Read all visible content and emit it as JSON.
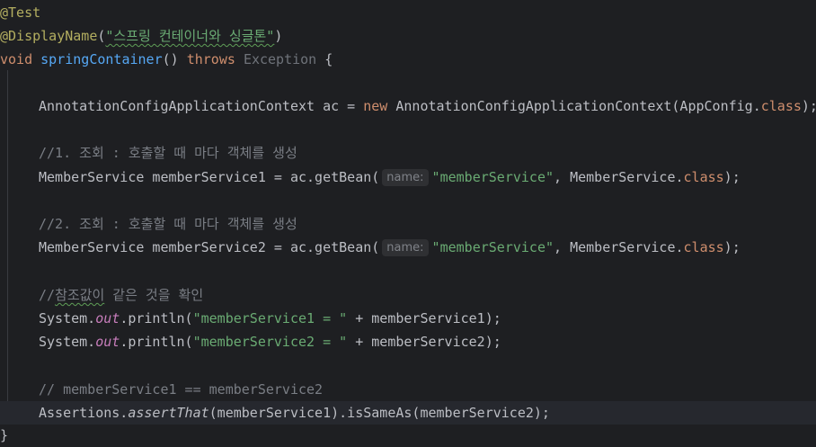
{
  "code": {
    "l1_annotation": "@Test",
    "l2_annotation": "@DisplayName",
    "l2_open": "(",
    "l2_string": "\"스프링 컨테이너와 싱글톤\"",
    "l2_close": ")",
    "l3_void": "void",
    "l3_method": "springContainer",
    "l3_parens": "()",
    "l3_throws": "throws",
    "l3_exception": "Exception",
    "l3_brace": "{",
    "l5_type": "AnnotationConfigApplicationContext ac = ",
    "l5_new": "new",
    "l5_ctor": " AnnotationConfigApplicationContext(AppConfig.",
    "l5_class_kw": "class",
    "l5_end": ");",
    "l7_comment": "//1. 조회 : 호출할 때 마다 객체를 생성",
    "l8_prefix": "MemberService memberService1 = ac.getBean(",
    "l8_hint": "name:",
    "l8_string": "\"memberService\"",
    "l8_mid": ", MemberService.",
    "l8_class_kw": "class",
    "l8_end": ");",
    "l10_comment": "//2. 조회 : 호출할 때 마다 객체를 생성",
    "l11_prefix": "MemberService memberService2 = ac.getBean(",
    "l11_hint": "name:",
    "l11_string": "\"memberService\"",
    "l11_mid": ", MemberService.",
    "l11_class_kw": "class",
    "l11_end": ");",
    "l13_comment_a": "//",
    "l13_comment_b": "참조값이",
    "l13_comment_c": " 같은 것을 확인",
    "l14_system": "System.",
    "l14_out": "out",
    "l14_println": ".println(",
    "l14_string": "\"memberService1 = \"",
    "l14_end": " + memberService1);",
    "l15_system": "System.",
    "l15_out": "out",
    "l15_println": ".println(",
    "l15_string": "\"memberService2 = \"",
    "l15_end": " + memberService2);",
    "l17_comment": "// memberService1 == memberService2",
    "l18_assertions": "Assertions.",
    "l18_assert_that": "assertThat",
    "l18_end": "(memberService1).isSameAs(memberService2);",
    "l19_brace": "}"
  },
  "colors": {
    "background": "#1e1f22",
    "current_line": "#26282e",
    "keyword": "#cf8e6d",
    "annotation": "#b3ae60",
    "method": "#56a8f5",
    "string": "#6aab73",
    "comment": "#7a7e85",
    "static_field": "#c77dbb"
  }
}
